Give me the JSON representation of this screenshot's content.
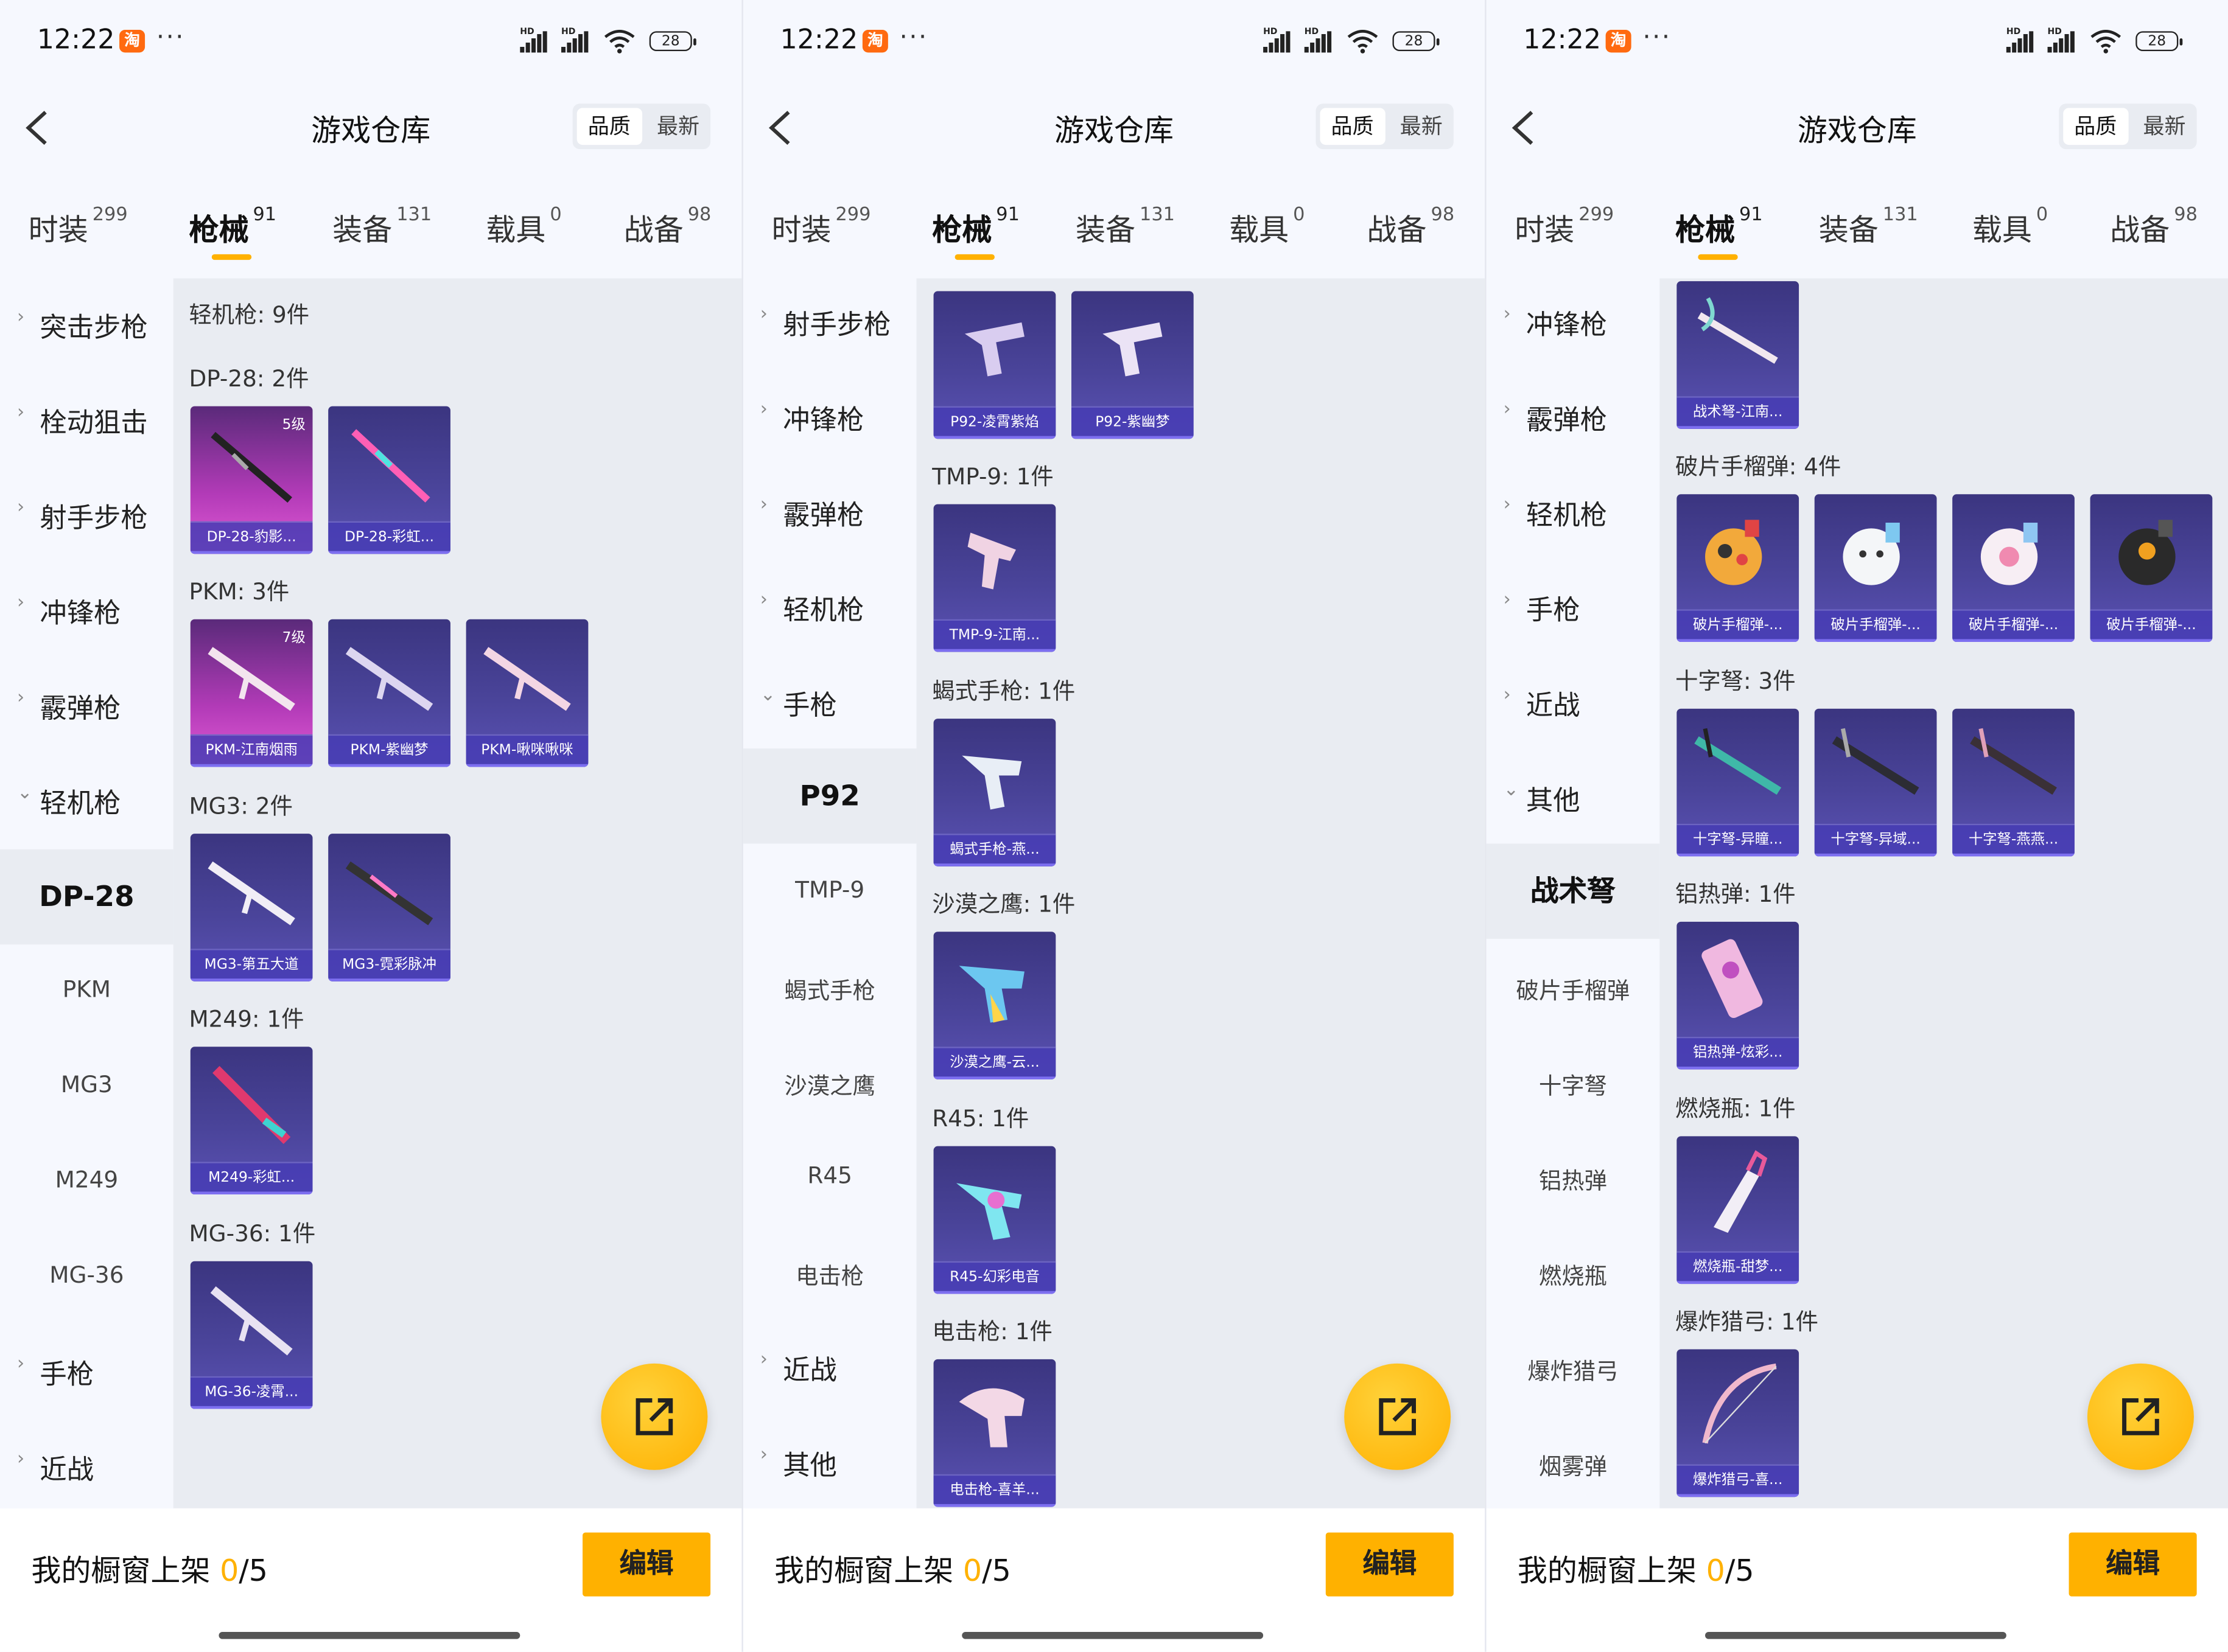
{
  "screens": [
    {
      "status": {
        "time": "12:22",
        "taobao": "淘",
        "dots": "···",
        "battery": "28"
      },
      "nav": {
        "title": "游戏仓库",
        "sort": [
          "品质",
          "最新"
        ]
      },
      "tabs": [
        {
          "label": "时装",
          "count": "299"
        },
        {
          "label": "枪械",
          "count": "91"
        },
        {
          "label": "装备",
          "count": "131"
        },
        {
          "label": "载具",
          "count": "0"
        },
        {
          "label": "战备",
          "count": "98"
        }
      ],
      "sidebar": {
        "categories_top": [
          "突击步枪",
          "栓动狙击",
          "射手步枪",
          "冲锋枪",
          "霰弹枪"
        ],
        "expanded": "轻机枪",
        "sub": [
          "DP-28",
          "PKM",
          "MG3",
          "M249",
          "MG-36"
        ],
        "categories_bottom": [
          "手枪",
          "近战"
        ]
      },
      "content": {
        "section": "轻机枪: 9件",
        "groups": [
          {
            "header": "DP-28: 2件",
            "items": [
              {
                "name": "DP-28-豹影...",
                "level": "5级"
              },
              {
                "name": "DP-28-彩虹..."
              }
            ]
          },
          {
            "header": "PKM: 3件",
            "items": [
              {
                "name": "PKM-江南烟雨",
                "level": "7级"
              },
              {
                "name": "PKM-紫幽梦"
              },
              {
                "name": "PKM-啾咪啾咪"
              }
            ]
          },
          {
            "header": "MG3: 2件",
            "items": [
              {
                "name": "MG3-第五大道"
              },
              {
                "name": "MG3-霓彩脉冲"
              }
            ]
          },
          {
            "header": "M249: 1件",
            "items": [
              {
                "name": "M249-彩虹..."
              }
            ]
          },
          {
            "header": "MG-36: 1件",
            "items": [
              {
                "name": "MG-36-凌霄..."
              }
            ]
          }
        ]
      },
      "bottom": {
        "label": "我的橱窗上架",
        "count": "0",
        "total": "/5",
        "edit": "编辑"
      }
    },
    {
      "status": {
        "time": "12:22",
        "taobao": "淘",
        "dots": "···",
        "battery": "28"
      },
      "nav": {
        "title": "游戏仓库",
        "sort": [
          "品质",
          "最新"
        ]
      },
      "tabs": [
        {
          "label": "时装",
          "count": "299"
        },
        {
          "label": "枪械",
          "count": "91"
        },
        {
          "label": "装备",
          "count": "131"
        },
        {
          "label": "载具",
          "count": "0"
        },
        {
          "label": "战备",
          "count": "98"
        }
      ],
      "sidebar": {
        "categories_top": [
          "射手步枪",
          "冲锋枪",
          "霰弹枪",
          "轻机枪"
        ],
        "expanded": "手枪",
        "sub": [
          "P92",
          "TMP-9",
          "蝎式手枪",
          "沙漠之鹰",
          "R45",
          "电击枪"
        ],
        "categories_bottom": [
          "近战",
          "其他"
        ]
      },
      "content": {
        "groups": [
          {
            "header": "",
            "items": [
              {
                "name": "P92-凌霄紫焰"
              },
              {
                "name": "P92-紫幽梦"
              }
            ]
          },
          {
            "header": "TMP-9: 1件",
            "items": [
              {
                "name": "TMP-9-江南..."
              }
            ]
          },
          {
            "header": "蝎式手枪: 1件",
            "items": [
              {
                "name": "蝎式手枪-燕..."
              }
            ]
          },
          {
            "header": "沙漠之鹰: 1件",
            "items": [
              {
                "name": "沙漠之鹰-云..."
              }
            ]
          },
          {
            "header": "R45: 1件",
            "items": [
              {
                "name": "R45-幻彩电音"
              }
            ]
          },
          {
            "header": "电击枪: 1件",
            "items": [
              {
                "name": "电击枪-喜羊..."
              }
            ]
          }
        ]
      },
      "bottom": {
        "label": "我的橱窗上架",
        "count": "0",
        "total": "/5",
        "edit": "编辑"
      }
    },
    {
      "status": {
        "time": "12:22",
        "taobao": "淘",
        "dots": "···",
        "battery": "28"
      },
      "nav": {
        "title": "游戏仓库",
        "sort": [
          "品质",
          "最新"
        ]
      },
      "tabs": [
        {
          "label": "时装",
          "count": "299"
        },
        {
          "label": "枪械",
          "count": "91"
        },
        {
          "label": "装备",
          "count": "131"
        },
        {
          "label": "载具",
          "count": "0"
        },
        {
          "label": "战备",
          "count": "98"
        }
      ],
      "sidebar": {
        "categories_top": [
          "冲锋枪",
          "霰弹枪",
          "轻机枪",
          "手枪",
          "近战"
        ],
        "expanded": "其他",
        "sub": [
          "战术弩",
          "破片手榴弹",
          "十字弩",
          "铝热弹",
          "燃烧瓶",
          "爆炸猎弓",
          "烟雾弹"
        ],
        "categories_bottom": []
      },
      "content": {
        "groups": [
          {
            "header": "",
            "items": [
              {
                "name": "战术弩-江南..."
              }
            ]
          },
          {
            "header": "破片手榴弹: 4件",
            "items": [
              {
                "name": "破片手榴弹-..."
              },
              {
                "name": "破片手榴弹-..."
              },
              {
                "name": "破片手榴弹-..."
              },
              {
                "name": "破片手榴弹-..."
              }
            ]
          },
          {
            "header": "十字弩: 3件",
            "items": [
              {
                "name": "十字弩-异瞳..."
              },
              {
                "name": "十字弩-异域..."
              },
              {
                "name": "十字弩-燕燕..."
              }
            ]
          },
          {
            "header": "铝热弹: 1件",
            "items": [
              {
                "name": "铝热弹-炫彩..."
              }
            ]
          },
          {
            "header": "燃烧瓶: 1件",
            "items": [
              {
                "name": "燃烧瓶-甜梦..."
              }
            ]
          },
          {
            "header": "爆炸猎弓: 1件",
            "items": [
              {
                "name": "爆炸猎弓-喜..."
              }
            ]
          }
        ]
      },
      "bottom": {
        "label": "我的橱窗上架",
        "count": "0",
        "total": "/5",
        "edit": "编辑"
      }
    }
  ],
  "colors": {
    "accent": "#ffb100",
    "card": "#4a449a",
    "card_pink": "#c23fbf",
    "background": "#f6f8fe",
    "content_bg": "#e9ecf2"
  },
  "icons": [
    "back-arrow-icon",
    "share-icon",
    "chevron-right-icon",
    "chevron-down-icon",
    "signal-icon",
    "wifi-icon",
    "battery-icon"
  ]
}
